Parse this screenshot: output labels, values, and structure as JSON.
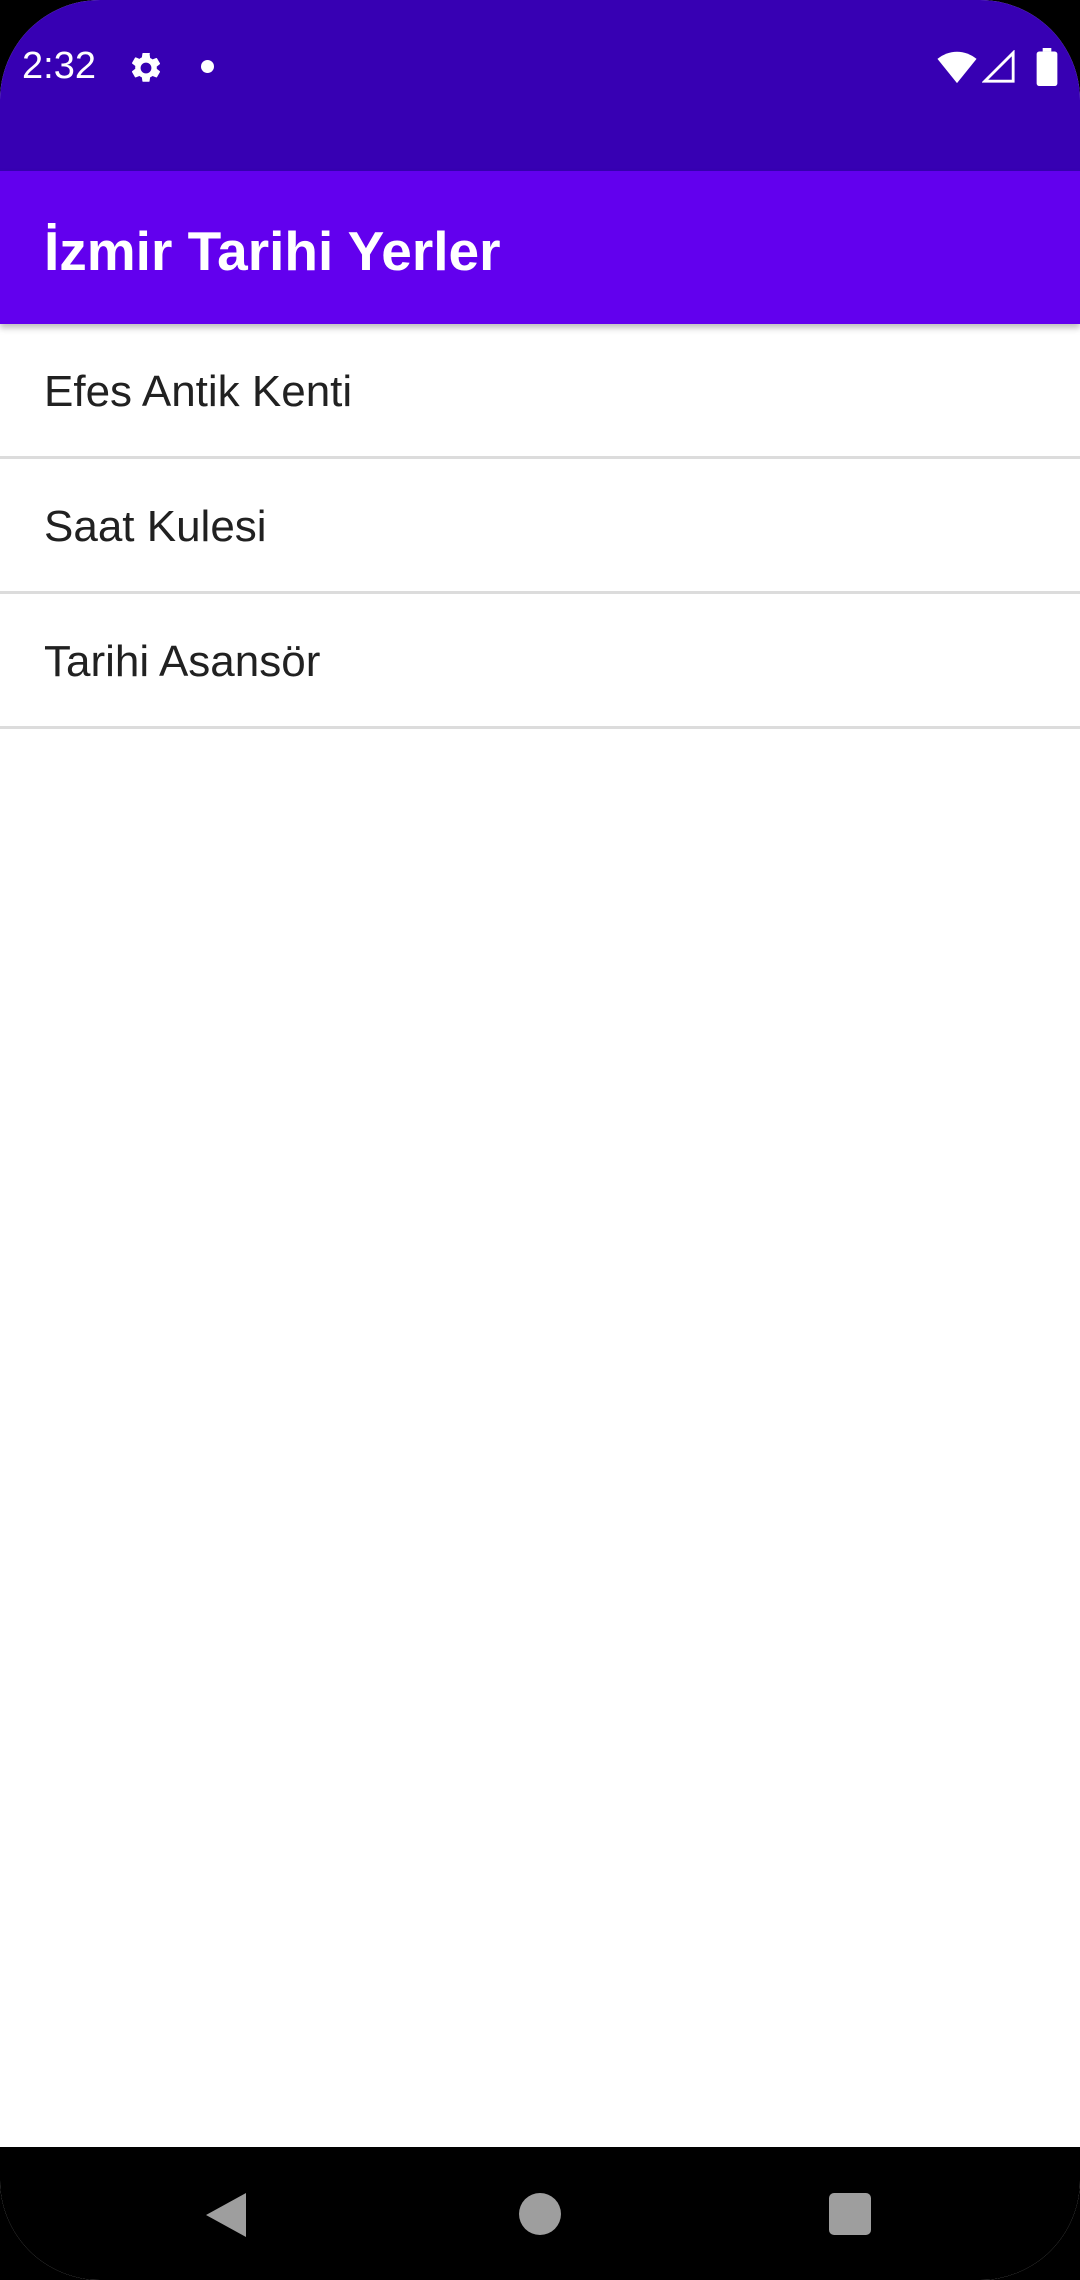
{
  "status_bar": {
    "time": "2:32",
    "icons": [
      "settings-icon",
      "notification-dot-icon",
      "wifi-icon",
      "cell-signal-icon",
      "battery-icon"
    ]
  },
  "app_bar": {
    "title": "İzmir Tarihi Yerler",
    "color": "#6200ee"
  },
  "status_bar_color": "#3700b3",
  "list": {
    "items": [
      {
        "label": "Efes Antik Kenti"
      },
      {
        "label": "Saat Kulesi"
      },
      {
        "label": "Tarihi Asansör"
      }
    ]
  },
  "nav_bar": {
    "icons": [
      "back-icon",
      "home-icon",
      "recents-icon"
    ]
  }
}
